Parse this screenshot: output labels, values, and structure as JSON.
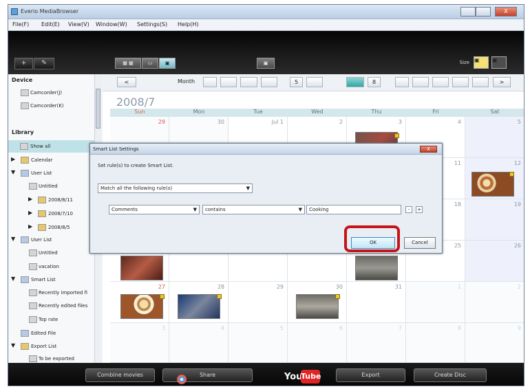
{
  "app": {
    "title": "Everio MediaBrowser",
    "window_buttons": [
      "",
      "",
      "X"
    ]
  },
  "menu": [
    "File(F)",
    "Edit(E)",
    "View(V)",
    "Window(W)",
    "Settings(S)",
    "Help(H)"
  ],
  "toolbar": {
    "left_buttons": [
      "+",
      "✎"
    ],
    "view_buttons": [
      "▦ ▦",
      "▭",
      "▣"
    ],
    "size_label": "Size",
    "size_buttons": [
      "▣",
      "▣"
    ]
  },
  "sidebar": {
    "device_header": "Device",
    "devices": [
      "Camcorder(J)",
      "Camcorder(K)"
    ],
    "library_header": "Library",
    "items": [
      {
        "label": "Show all",
        "selected": true
      },
      {
        "label": "Calendar"
      },
      {
        "label": "User List"
      },
      {
        "label": "Untitled"
      },
      {
        "label": "2008/8/11"
      },
      {
        "label": "2008/7/10"
      },
      {
        "label": "2008/8/5"
      },
      {
        "label": "User List"
      },
      {
        "label": "Untitled"
      },
      {
        "label": "vacation"
      },
      {
        "label": "Smart List"
      },
      {
        "label": "Recently imported fi"
      },
      {
        "label": "Recently edited files"
      },
      {
        "label": "Top rate"
      },
      {
        "label": "Edited File"
      },
      {
        "label": "Export List"
      },
      {
        "label": "To be exported"
      }
    ]
  },
  "calendar": {
    "nav": [
      "<",
      "Month",
      "",
      "",
      "",
      "",
      "5",
      "",
      "",
      "8",
      "",
      "",
      "",
      "",
      "",
      ">"
    ],
    "title": "2008/7",
    "weekdays": [
      "Sun",
      "Mon",
      "Tue",
      "Wed",
      "Thu",
      "Fri",
      "Sat"
    ],
    "week1": [
      "29",
      "30",
      "Jul 1",
      "2",
      "3",
      "4",
      "5"
    ],
    "week2_right": [
      "11",
      "12"
    ],
    "week3_right": [
      "18",
      "19"
    ],
    "week4_right": [
      "25",
      "26"
    ],
    "week5": [
      "27",
      "28",
      "29",
      "30",
      "31",
      "1",
      "2"
    ],
    "week6": [
      "3",
      "4",
      "5",
      "6",
      "7",
      "8",
      "9"
    ]
  },
  "dialog": {
    "title": "Smart List Settings",
    "instruction": "Set rule(s) to create Smart List.",
    "match_option": "Match all the following rule(s)",
    "field_option": "Comments",
    "operator_option": "contains",
    "value": "Cooking",
    "minus": "-",
    "plus": "+",
    "ok": "OK",
    "cancel": "Cancel",
    "close": "X"
  },
  "bottom": {
    "buttons": [
      "Combine movies",
      "Share",
      "You",
      "Tube",
      "Export",
      "Create Disc"
    ]
  },
  "colors": {
    "highlight": "#c51419",
    "selection": "#bfe2e8",
    "youtube_red": "#e12424"
  }
}
